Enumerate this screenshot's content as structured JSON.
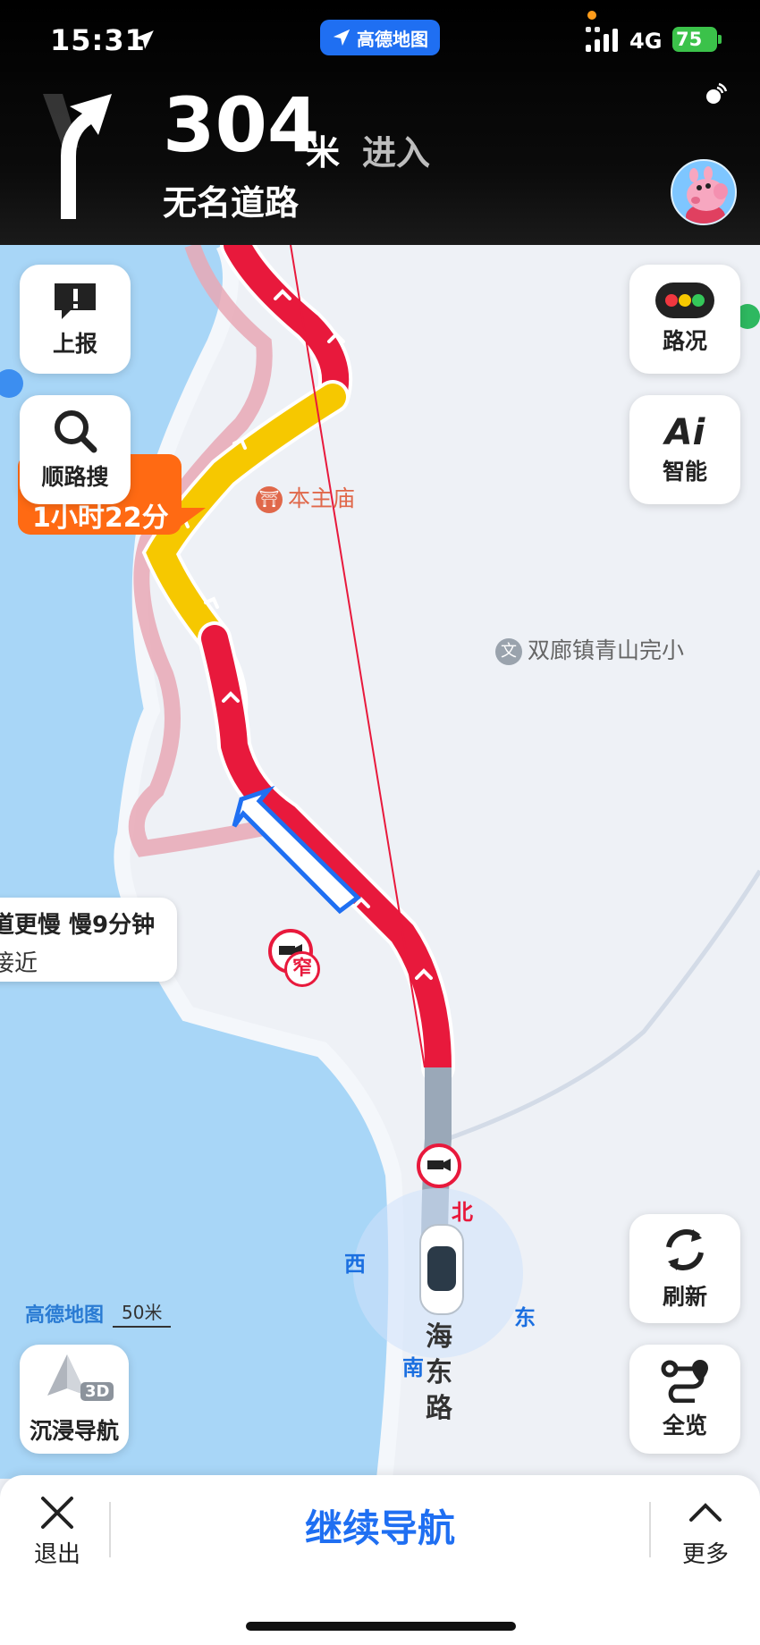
{
  "status_bar": {
    "time": "15:31",
    "app_name": "高德地图",
    "network": "4G",
    "battery": "75"
  },
  "nav": {
    "distance": "304",
    "unit": "米",
    "action": "进入",
    "road_name": "无名道路"
  },
  "left_buttons": {
    "report": "上报",
    "search_along": "顺路搜"
  },
  "right_buttons": {
    "traffic": "路况",
    "ai_logo": "Ai",
    "ai": "智能",
    "refresh": "刷新",
    "overview": "全览"
  },
  "eta": "1小时22分",
  "alt_route_tip": {
    "line1": "道更慢 慢9分钟",
    "line2": "接近"
  },
  "pois": {
    "temple": "本主庙",
    "school": "双廊镇青山完小"
  },
  "map_badges": {
    "narrow": "窄"
  },
  "compass": {
    "north": "北",
    "south": "南",
    "east": "东",
    "west": "西"
  },
  "scale": {
    "brand": "高德地图",
    "value": "50米"
  },
  "street": {
    "name": "海东路"
  },
  "immersive": {
    "badge": "3D",
    "label": "沉浸导航"
  },
  "bottom_bar": {
    "exit": "退出",
    "continue": "继续导航",
    "more": "更多"
  },
  "colors": {
    "accent": "#1f6ff2",
    "congestion_red": "#e8193c",
    "slow_yellow": "#f6c800",
    "water": "#a8d6f7",
    "eta_orange": "#ff6a13"
  }
}
